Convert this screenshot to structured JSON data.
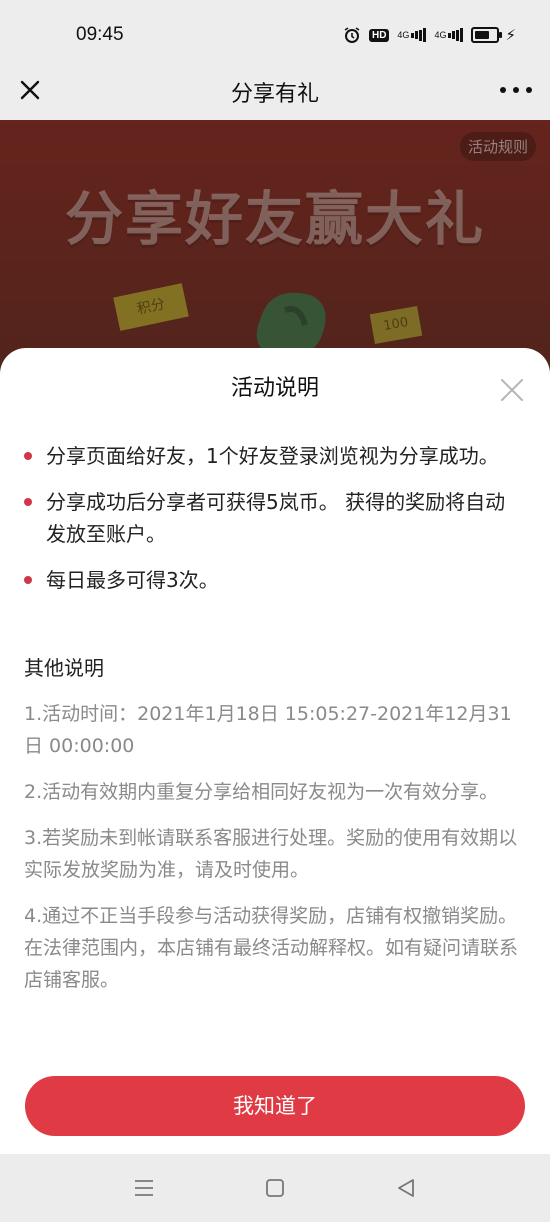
{
  "status_bar": {
    "time": "09:45",
    "hd_label": "HD",
    "signal_1_label": "4G",
    "signal_2_label": "4G",
    "icons": [
      "alarm-icon",
      "hd-icon",
      "signal-4g-icon",
      "signal-4g-icon",
      "battery-icon",
      "charging-icon"
    ]
  },
  "nav": {
    "title": "分享有礼",
    "close_icon": "close-icon",
    "more_icon": "more-icon"
  },
  "background_page": {
    "rules_label": "活动规则",
    "banner_title": "分享好友赢大礼",
    "points_label": "积分",
    "hundred_label": "100"
  },
  "modal": {
    "title": "活动说明",
    "bullets": [
      "分享页面给好友，1个好友登录浏览视为分享成功。",
      "分享成功后分享者可获得5岚币。 获得的奖励将自动发放至账户。",
      "每日最多可得3次。"
    ],
    "other_title": "其他说明",
    "notes": [
      "1.活动时间：2021年1月18日 15:05:27-2021年12月31日 00:00:00",
      "2.活动有效期内重复分享给相同好友视为一次有效分享。",
      "3.若奖励未到帐请联系客服进行处理。奖励的使用有效期以实际发放奖励为准，请及时使用。",
      "4.通过不正当手段参与活动获得奖励，店铺有权撤销奖励。在法律范围内，本店铺有最终活动解释权。如有疑问请联系店铺客服。"
    ],
    "ok_label": "我知道了"
  },
  "colors": {
    "accent": "#e03a44",
    "bullet": "#d2354a",
    "note_text": "#8a8a8a"
  }
}
